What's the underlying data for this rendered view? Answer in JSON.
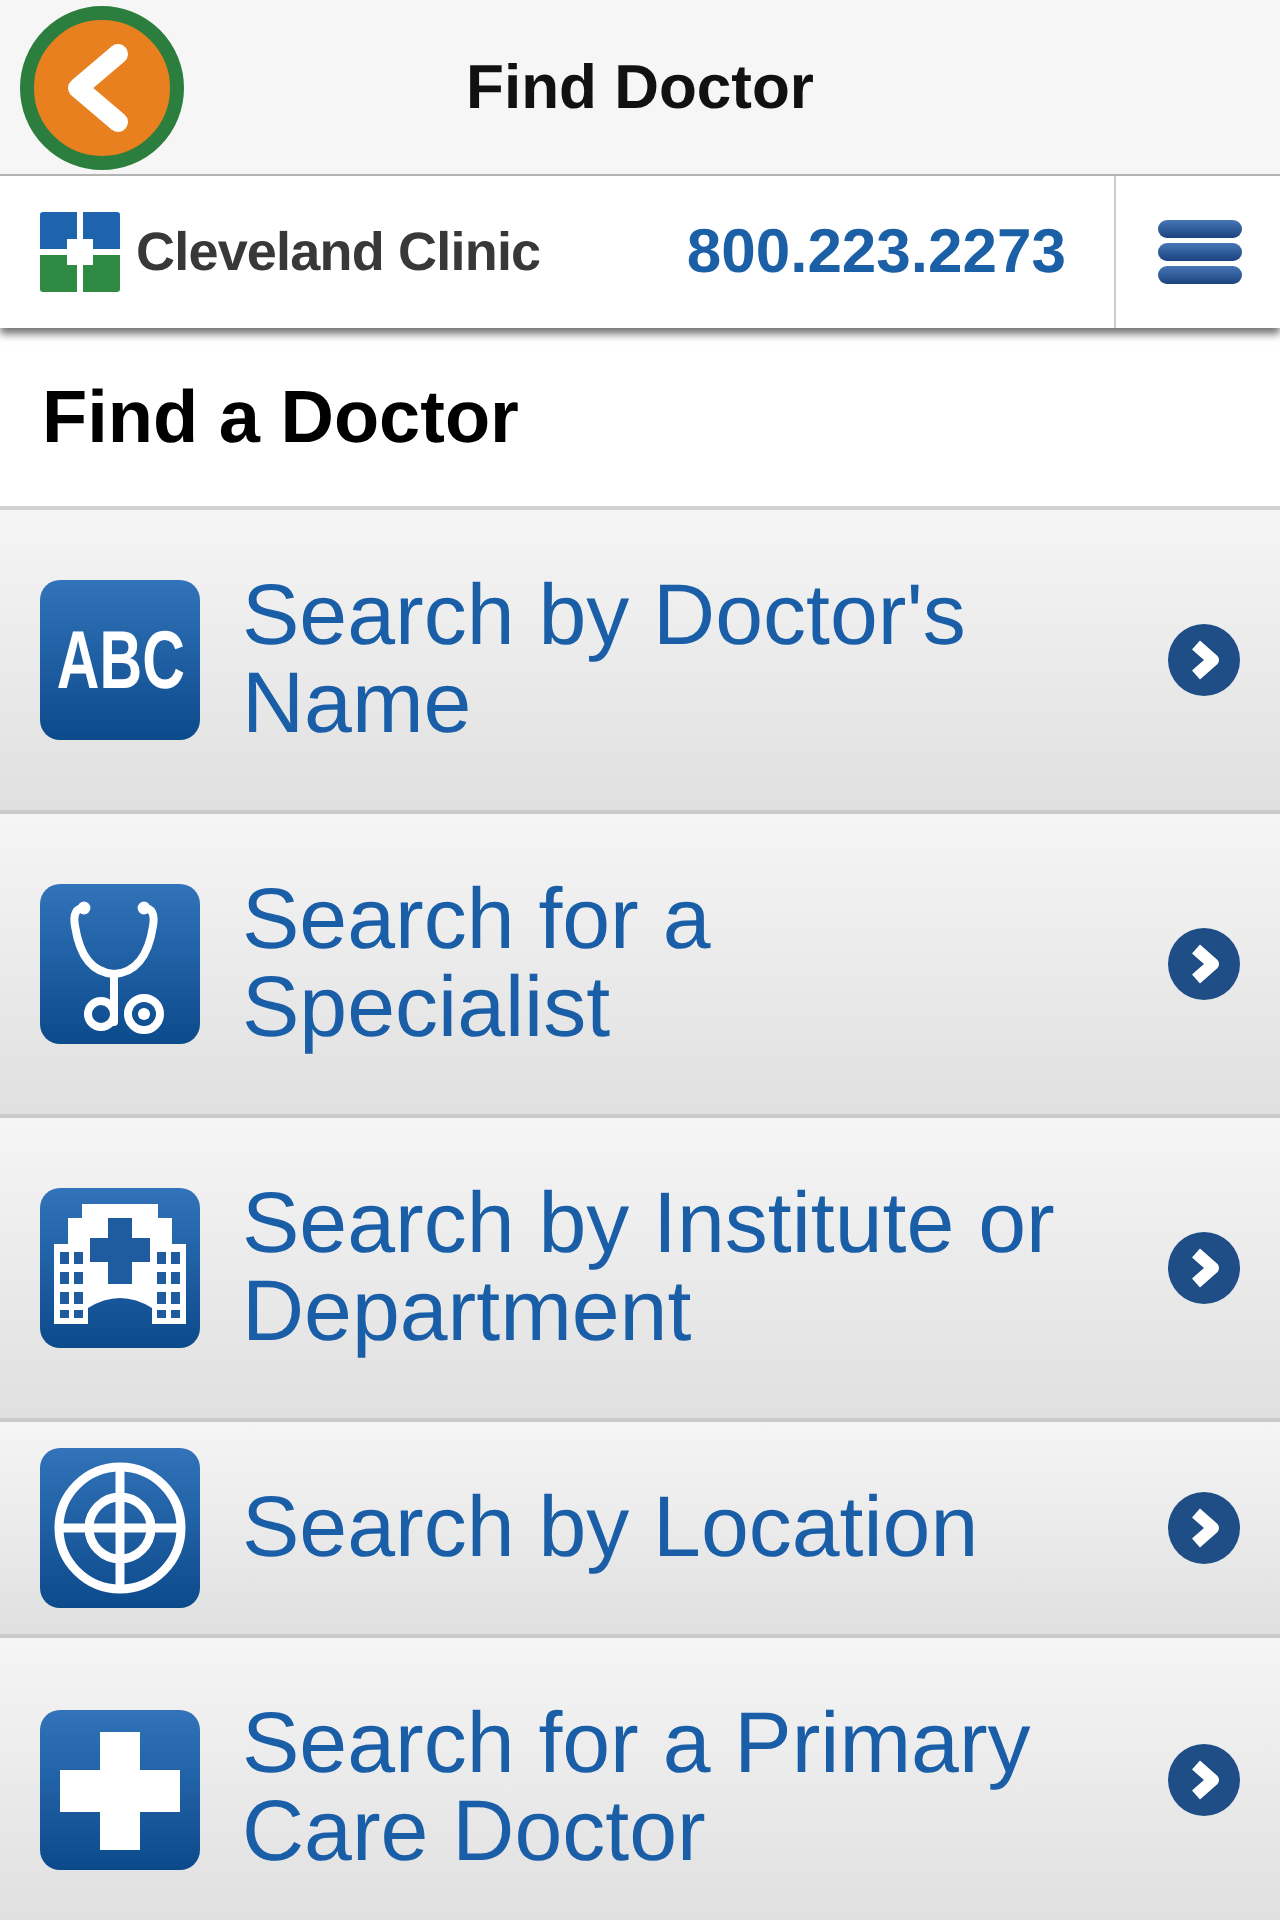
{
  "nav": {
    "title": "Find Doctor"
  },
  "header": {
    "brand": "Cleveland Clinic",
    "phone": "800.223.2273"
  },
  "page": {
    "heading": "Find a Doctor"
  },
  "options": [
    {
      "kind": "letters",
      "icon_text": "ABC",
      "label": "Search by Doctor's Name"
    },
    {
      "kind": "stethoscope",
      "label": "Search for a Specialist"
    },
    {
      "kind": "building",
      "label": "Search by Institute or Department"
    },
    {
      "kind": "target",
      "label": "Search by Location"
    },
    {
      "kind": "cross",
      "label": "Search for a Primary Care Doctor"
    }
  ]
}
